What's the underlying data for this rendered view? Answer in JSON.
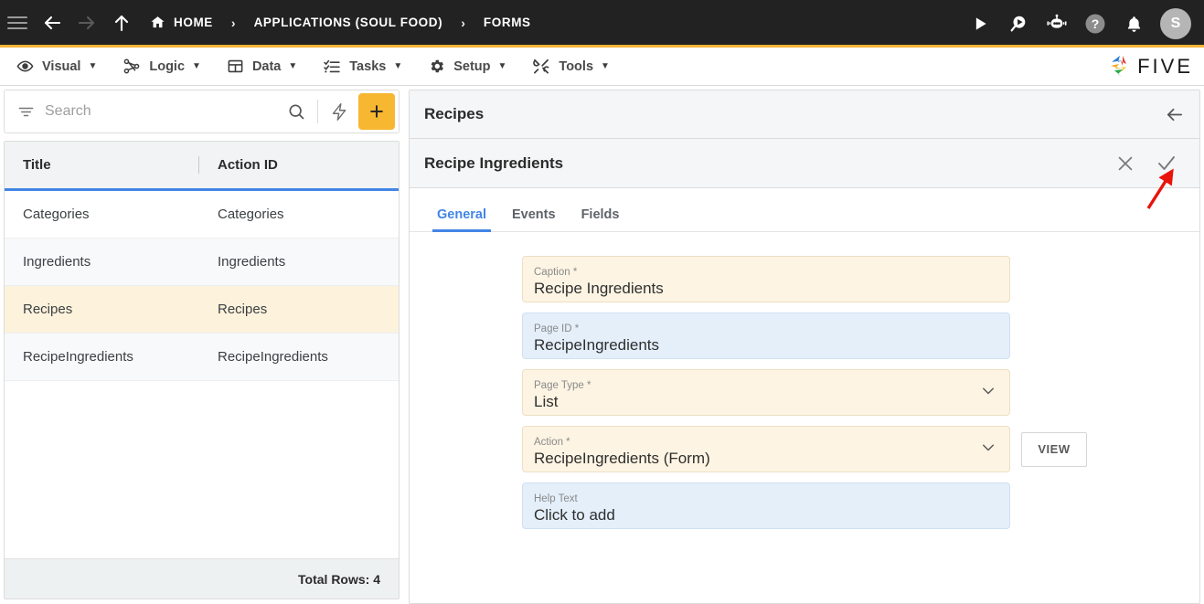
{
  "topbar": {
    "icons": {
      "menu": "hamburger-icon",
      "back": "arrow-left-icon",
      "forward": "arrow-right-icon",
      "up": "arrow-up-icon"
    },
    "breadcrumbs": [
      {
        "label": "HOME",
        "icon": "home-icon"
      },
      {
        "label": "APPLICATIONS (SOUL FOOD)",
        "icon": ""
      },
      {
        "label": "FORMS",
        "icon": ""
      }
    ],
    "separator": "›",
    "actions": [
      {
        "name": "run-icon",
        "label": ""
      },
      {
        "name": "debug-run-icon",
        "label": ""
      },
      {
        "name": "robot-assistant-icon",
        "label": ""
      },
      {
        "name": "help-icon",
        "label": ""
      },
      {
        "name": "notifications-bell-icon",
        "label": ""
      }
    ],
    "avatar_initial": "S",
    "accent_color": "#F5B335",
    "background_color": "#222222"
  },
  "menubar": {
    "items": [
      {
        "label": "Visual",
        "icon": "eye-icon",
        "caret": "▼"
      },
      {
        "label": "Logic",
        "icon": "logic-nodes-icon",
        "caret": "▼"
      },
      {
        "label": "Data",
        "icon": "table-icon",
        "caret": "▼"
      },
      {
        "label": "Tasks",
        "icon": "checklist-icon",
        "caret": "▼"
      },
      {
        "label": "Setup",
        "icon": "gear-icon",
        "caret": "▼"
      },
      {
        "label": "Tools",
        "icon": "tools-icon",
        "caret": "▼"
      }
    ],
    "logo_text": "FIVE"
  },
  "sidebar": {
    "search": {
      "placeholder": "Search",
      "value": "",
      "filter_icon": "filter-icon",
      "search_icon": "search-icon",
      "bolt_icon": "lightning-icon",
      "add_label": "+"
    },
    "grid": {
      "columns": [
        "Title",
        "Action ID"
      ],
      "rows": [
        {
          "title": "Categories",
          "action_id": "Categories",
          "selected": false
        },
        {
          "title": "Ingredients",
          "action_id": "Ingredients",
          "selected": false
        },
        {
          "title": "Recipes",
          "action_id": "Recipes",
          "selected": true
        },
        {
          "title": "RecipeIngredients",
          "action_id": "RecipeIngredients",
          "selected": false
        }
      ],
      "footer": "Total Rows: 4",
      "selected_row_color": "#FDF2DC",
      "header_underline_color": "#4285E5"
    }
  },
  "detail": {
    "header_title": "Recipes",
    "back_icon": "arrow-left-icon",
    "record_title": "Recipe Ingredients",
    "header_actions": [
      {
        "name": "cancel-icon",
        "glyph": "✕"
      },
      {
        "name": "save-check-icon",
        "glyph": "✓"
      }
    ],
    "tabs": [
      {
        "label": "General",
        "active": true
      },
      {
        "label": "Events",
        "active": false
      },
      {
        "label": "Fields",
        "active": false
      }
    ],
    "fields": [
      {
        "label": "Caption *",
        "value": "Recipe Ingredients",
        "style": "cream",
        "dropdown": false,
        "button": null
      },
      {
        "label": "Page ID *",
        "value": "RecipeIngredients",
        "style": "blue",
        "dropdown": false,
        "button": null
      },
      {
        "label": "Page Type *",
        "value": "List",
        "style": "cream",
        "dropdown": true,
        "button": null
      },
      {
        "label": "Action *",
        "value": "RecipeIngredients (Form)",
        "style": "cream",
        "dropdown": true,
        "button": "VIEW"
      },
      {
        "label": "Help Text",
        "value": "Click to add",
        "style": "blue",
        "dropdown": false,
        "button": null
      }
    ]
  },
  "annotation": {
    "arrow_color": "#E8130B",
    "points_to": "save-check-icon"
  }
}
